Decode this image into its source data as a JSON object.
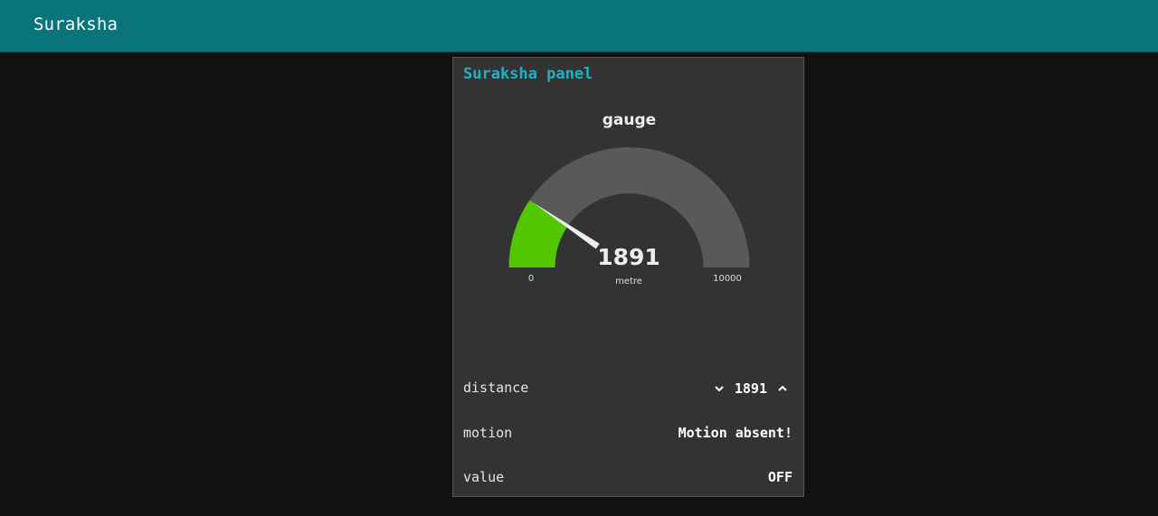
{
  "header": {
    "title": "Suraksha"
  },
  "panel": {
    "title": "Suraksha panel",
    "gauge": {
      "title": "gauge",
      "value": 1891,
      "value_label": "1891",
      "units": "metre",
      "min": 0,
      "max": 10000,
      "min_label": "0",
      "max_label": "10000",
      "fill_color": "#54c600",
      "track_color": "#595959",
      "needle_color": "#eeeeee"
    },
    "rows": [
      {
        "label": "distance",
        "value": "1891"
      },
      {
        "label": "motion",
        "value": "Motion absent!"
      },
      {
        "label": "value",
        "value": "OFF"
      }
    ],
    "stepper": {
      "decrement_icon": "chevron-down-icon",
      "increment_icon": "chevron-up-icon"
    }
  }
}
